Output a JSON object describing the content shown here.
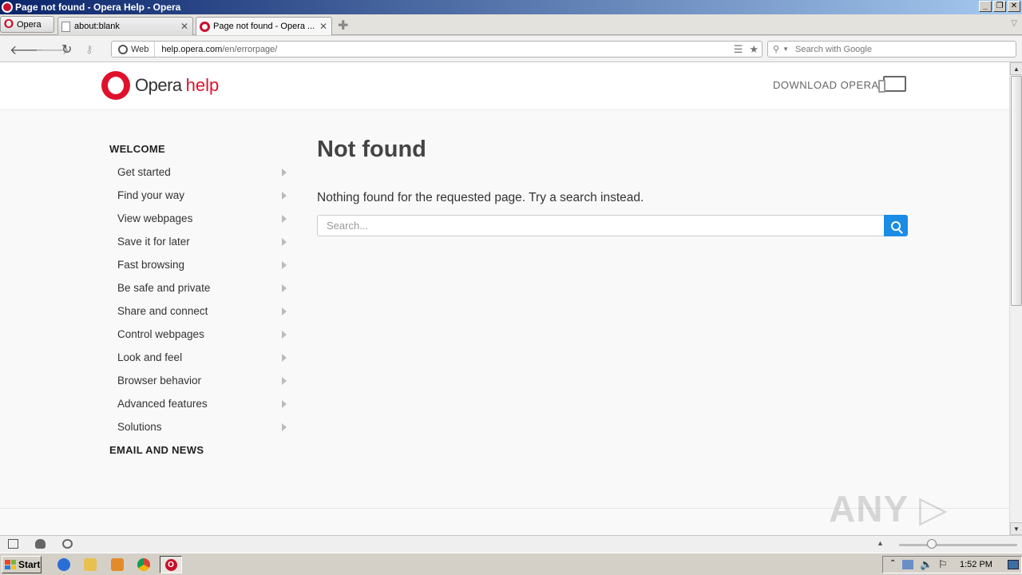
{
  "window": {
    "title": "Page not found - Opera Help - Opera"
  },
  "menu": {
    "label": "Opera"
  },
  "tabs": [
    {
      "label": "about:blank",
      "active": false
    },
    {
      "label": "Page not found - Opera ...",
      "active": true
    }
  ],
  "address": {
    "web_label": "Web",
    "url_host": "help.opera.com",
    "url_path": "/en/errorpage/",
    "search_placeholder": "Search with Google"
  },
  "site": {
    "logo_word": "Opera",
    "logo_accent": "help",
    "download": "DOWNLOAD OPERA",
    "accent_color": "#e0112b"
  },
  "sidebar": {
    "heading": "WELCOME",
    "items": [
      {
        "label": "Get started"
      },
      {
        "label": "Find your way"
      },
      {
        "label": "View webpages"
      },
      {
        "label": "Save it for later"
      },
      {
        "label": "Fast browsing"
      },
      {
        "label": "Be safe and private"
      },
      {
        "label": "Share and connect"
      },
      {
        "label": "Control webpages"
      },
      {
        "label": "Look and feel"
      },
      {
        "label": "Browser behavior"
      },
      {
        "label": "Advanced features"
      },
      {
        "label": "Solutions"
      }
    ],
    "heading2": "EMAIL AND NEWS"
  },
  "main": {
    "title": "Not found",
    "message": "Nothing found for the requested page. Try a search instead.",
    "search_placeholder": "Search...",
    "search_button_color": "#1a8ce6"
  },
  "watermark": "ANY RUN",
  "taskbar": {
    "start": "Start",
    "clock": "1:52 PM"
  }
}
